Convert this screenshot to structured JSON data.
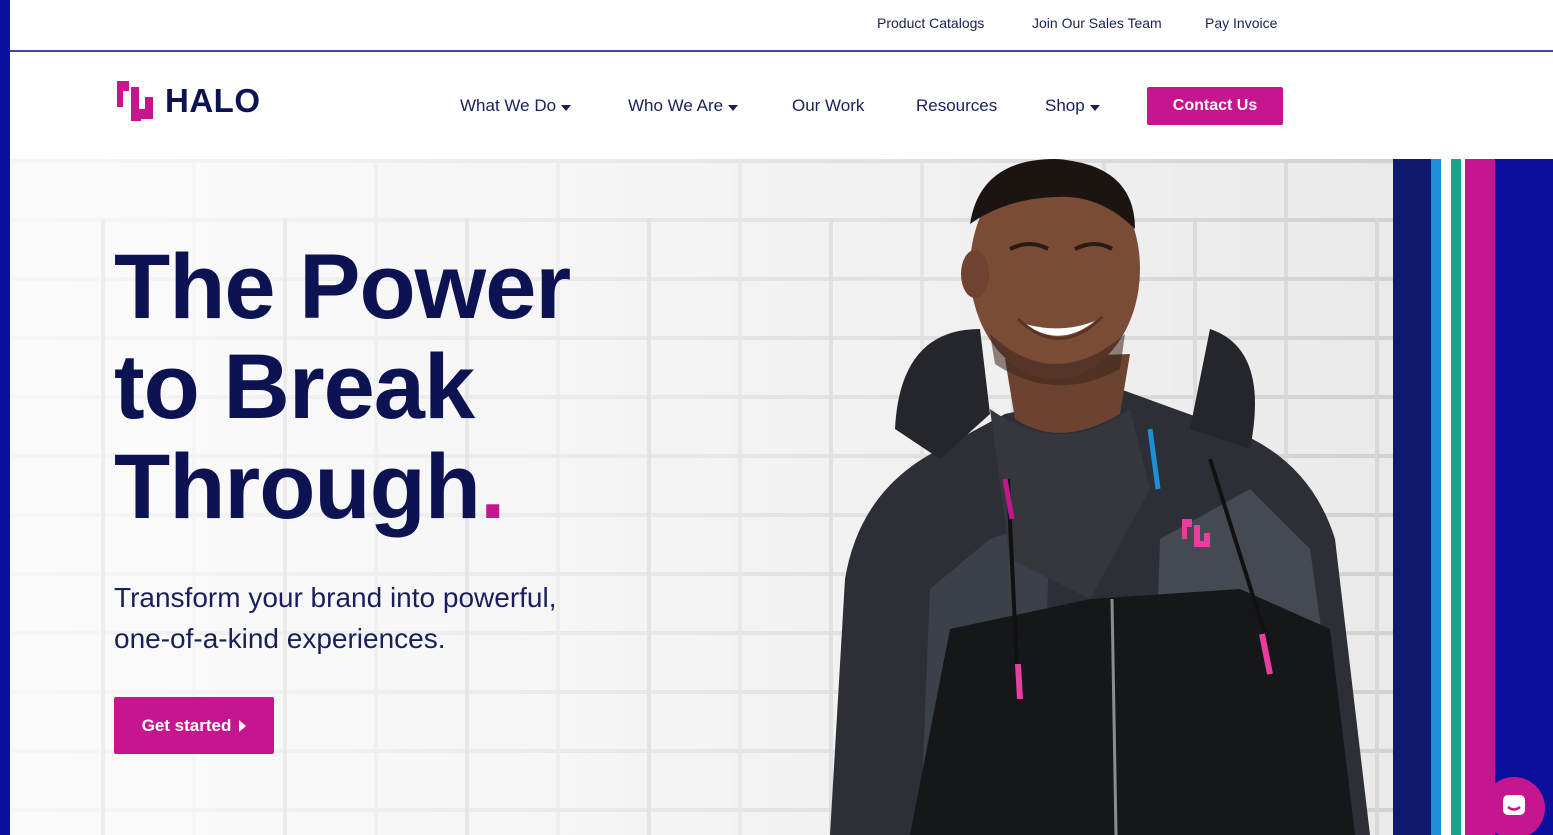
{
  "utility_bar": {
    "links": [
      "Product Catalogs",
      "Join Our Sales Team",
      "Pay Invoice"
    ]
  },
  "nav": {
    "logo_text": "HALO",
    "items": [
      {
        "label": "What We Do",
        "dropdown": true
      },
      {
        "label": "Who We Are",
        "dropdown": true
      },
      {
        "label": "Our Work",
        "dropdown": false
      },
      {
        "label": "Resources",
        "dropdown": false
      },
      {
        "label": "Shop",
        "dropdown": true
      }
    ],
    "contact_label": "Contact Us"
  },
  "hero": {
    "headline_line1": "The Power",
    "headline_line2": "to Break",
    "headline_line3": "Through",
    "headline_dot": ".",
    "subtitle_line1": "Transform your brand into powerful,",
    "subtitle_line2": "one-of-a-kind experiences.",
    "cta_label": "Get started"
  },
  "colors": {
    "brand_magenta": "#c5168f",
    "brand_navy": "#0d1252",
    "frame_blue": "#0a0f9e",
    "stripe_colors": [
      "#0d1a6e",
      "#1e8fd6",
      "#ffffff",
      "#1aa38c",
      "#ffffff",
      "#c5168f",
      "#0a0f9e"
    ]
  },
  "icons": {
    "logo_mark": "halo-logo-mark-icon",
    "dropdown": "caret-down-icon",
    "cta_arrow": "play-arrow-icon",
    "chat": "chat-bubble-icon"
  }
}
